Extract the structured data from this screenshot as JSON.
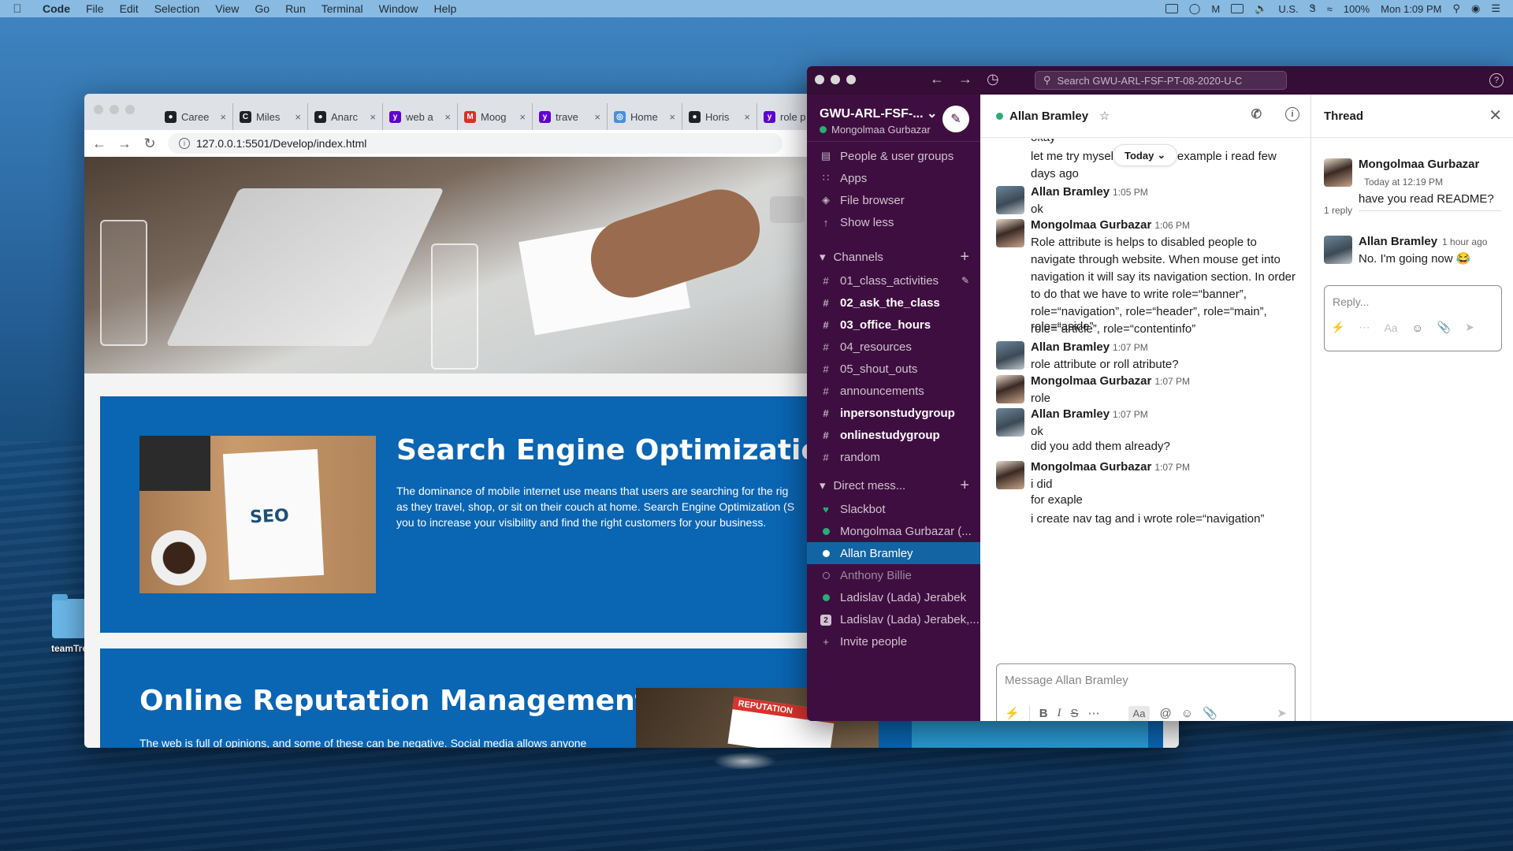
{
  "menubar": {
    "app": "Code",
    "items": [
      "File",
      "Edit",
      "Selection",
      "View",
      "Go",
      "Run",
      "Terminal",
      "Window",
      "Help"
    ],
    "right": {
      "input": "U.S.",
      "battery": "100%",
      "clock": "Mon 1:09 PM"
    }
  },
  "desktop": {
    "folder_label": "teamTre"
  },
  "browser": {
    "tabs": [
      {
        "label": "Caree",
        "icon": "github-icon",
        "color": "#202124"
      },
      {
        "label": "Miles",
        "icon": "cs-icon",
        "color": "#202124"
      },
      {
        "label": "Anarc",
        "icon": "github-icon",
        "color": "#202124"
      },
      {
        "label": "web a",
        "icon": "yahoo-icon",
        "color": "#5f01d1"
      },
      {
        "label": "Moog",
        "icon": "gmail-icon",
        "color": "#d93025"
      },
      {
        "label": "trave",
        "icon": "yahoo-icon",
        "color": "#5f01d1"
      },
      {
        "label": "Home",
        "icon": "globe-icon",
        "color": "#4a90d9"
      },
      {
        "label": "Horis",
        "icon": "github-icon",
        "color": "#202124"
      },
      {
        "label": "role p",
        "icon": "yahoo-icon",
        "color": "#5f01d1"
      }
    ],
    "url": "127.0.0.1:5501/Develop/index.html",
    "page": {
      "seo_title": "Search Engine Optimization",
      "seo_text_1": "The dominance of mobile internet use means that users are searching for the rig",
      "seo_text_2": "as they travel, shop, or sit on their couch at home. Search Engine Optimization (S",
      "seo_text_3": "you to increase your visibility and find the right customers for your business.",
      "seo_image_text": "SEO",
      "orm_title": "Online Reputation Management",
      "orm_text": "The web is full of opinions, and some of these can be negative. Social media allows anyone",
      "orm_image_text": "REPUTATION"
    }
  },
  "slack": {
    "search_placeholder": "Search GWU-ARL-FSF-PT-08-2020-U-C",
    "workspace": "GWU-ARL-FSF-...",
    "current_user": "Mongolmaa Gurbazar",
    "nav": [
      "People & user groups",
      "Apps",
      "File browser",
      "Show less"
    ],
    "channels_header": "Channels",
    "channels": [
      {
        "name": "01_class_activities",
        "bold": false
      },
      {
        "name": "02_ask_the_class",
        "bold": true
      },
      {
        "name": "03_office_hours",
        "bold": true
      },
      {
        "name": "04_resources",
        "bold": false
      },
      {
        "name": "05_shout_outs",
        "bold": false
      },
      {
        "name": "announcements",
        "bold": false
      },
      {
        "name": "inpersonstudygroup",
        "bold": true
      },
      {
        "name": "onlinestudygroup",
        "bold": true
      },
      {
        "name": "random",
        "bold": false
      }
    ],
    "dm_header": "Direct mess...",
    "dms": [
      {
        "name": "Slackbot",
        "status": "heart"
      },
      {
        "name": "Mongolmaa Gurbazar  (...",
        "status": "online"
      },
      {
        "name": "Allan Bramley",
        "status": "active"
      },
      {
        "name": "Anthony Billie",
        "status": "away"
      },
      {
        "name": "Ladislav (Lada) Jerabek",
        "status": "online"
      },
      {
        "name": "Ladislav (Lada) Jerabek,...",
        "status": "group"
      }
    ],
    "invite": "Invite people",
    "chat": {
      "title": "Allan Bramley",
      "today_label": "Today",
      "messages": [
        {
          "author": "",
          "time": "",
          "text": "okay"
        },
        {
          "author": "",
          "time": "",
          "text": "let me try mysel    and simple example i read few days ago"
        },
        {
          "author": "Allan Bramley",
          "time": "1:05 PM",
          "text": "ok"
        },
        {
          "author": "Mongolmaa Gurbazar",
          "time": "1:06 PM",
          "text": "Role attribute is helps to disabled people to navigate through website. When mouse get into navigation it will say its navigation section.  In order to do that we have to write role=“banner”, role=“navigation”, role=“header”, role=“main”, role=“article”, role=“contentinfo”"
        },
        {
          "author": "",
          "time": "",
          "text": "role=“aside”"
        },
        {
          "author": "Allan Bramley",
          "time": "1:07 PM",
          "text": "role attribute or roll atribute?"
        },
        {
          "author": "Mongolmaa Gurbazar",
          "time": "1:07 PM",
          "text": "role"
        },
        {
          "author": "Allan Bramley",
          "time": "1:07 PM",
          "text": "ok"
        },
        {
          "author": "",
          "time": "",
          "text": "did  you add them already?"
        },
        {
          "author": "Mongolmaa Gurbazar",
          "time": "1:07 PM",
          "text": "i did"
        },
        {
          "author": "",
          "time": "",
          "text": "for exaple"
        },
        {
          "author": "",
          "time": "",
          "text": "i create nav tag and i wrote role=“navigation”"
        }
      ],
      "composer_placeholder": "Message Allan Bramley"
    },
    "thread": {
      "title": "Thread",
      "parent": {
        "author": "Mongolmaa Gurbazar",
        "time": "Today at 12:19 PM",
        "text": "have you read README?"
      },
      "reply_count": "1 reply",
      "reply": {
        "author": "Allan Bramley",
        "time": "1 hour ago",
        "text": "No.  I'm going now 😂"
      },
      "reply_placeholder": "Reply..."
    }
  }
}
